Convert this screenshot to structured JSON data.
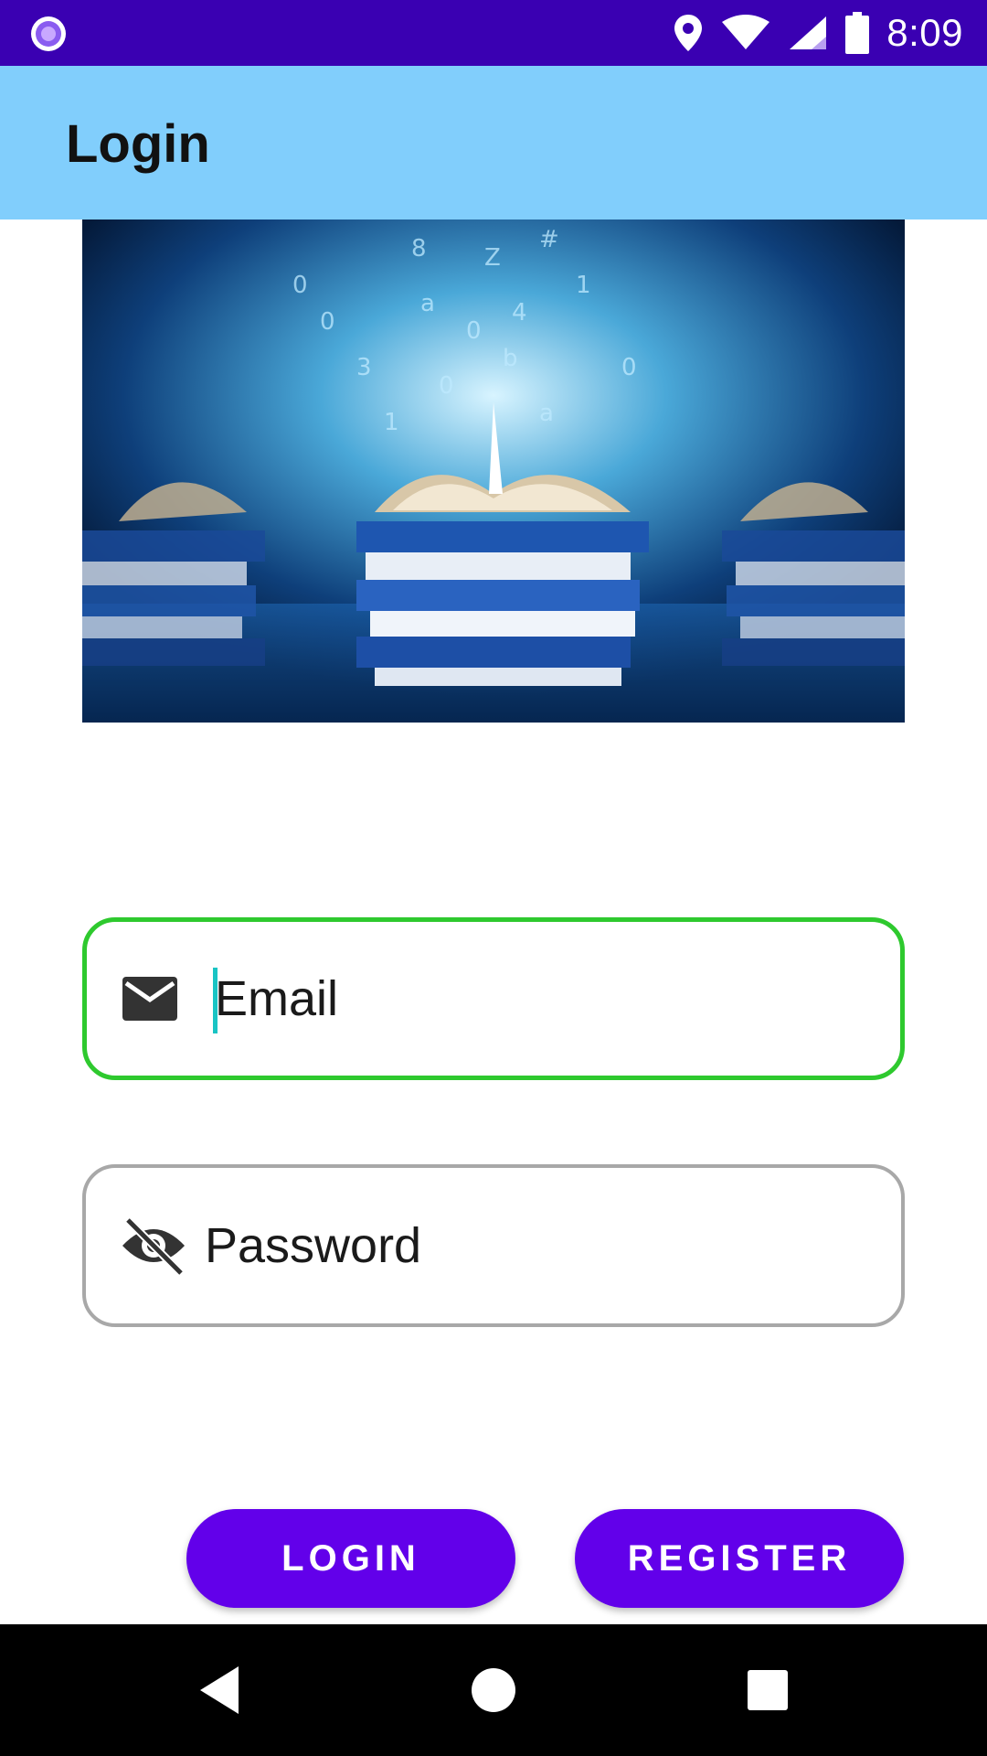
{
  "status_bar": {
    "time": "8:09",
    "icons": [
      "app-notification-icon",
      "location-icon",
      "wifi-icon",
      "signal-icon",
      "battery-icon"
    ]
  },
  "app_bar": {
    "title": "Login"
  },
  "hero_image": {
    "description_icon": "books-image"
  },
  "form": {
    "email": {
      "placeholder": "Email",
      "value": "",
      "icon": "mail-icon",
      "focused": true,
      "border_color": "#2ec92e"
    },
    "password": {
      "placeholder": "Password",
      "value": "",
      "icon": "visibility-off-icon",
      "border_color": "#a8a8a8"
    }
  },
  "buttons": {
    "login": "LOGIN",
    "register": "REGISTER"
  },
  "nav_bar": {
    "icons": [
      "back-icon",
      "home-icon",
      "recents-icon"
    ]
  },
  "colors": {
    "status_bar": "#3a00b2",
    "app_bar": "#81cefc",
    "button": "#6200ea",
    "caret": "#19c4c4"
  }
}
